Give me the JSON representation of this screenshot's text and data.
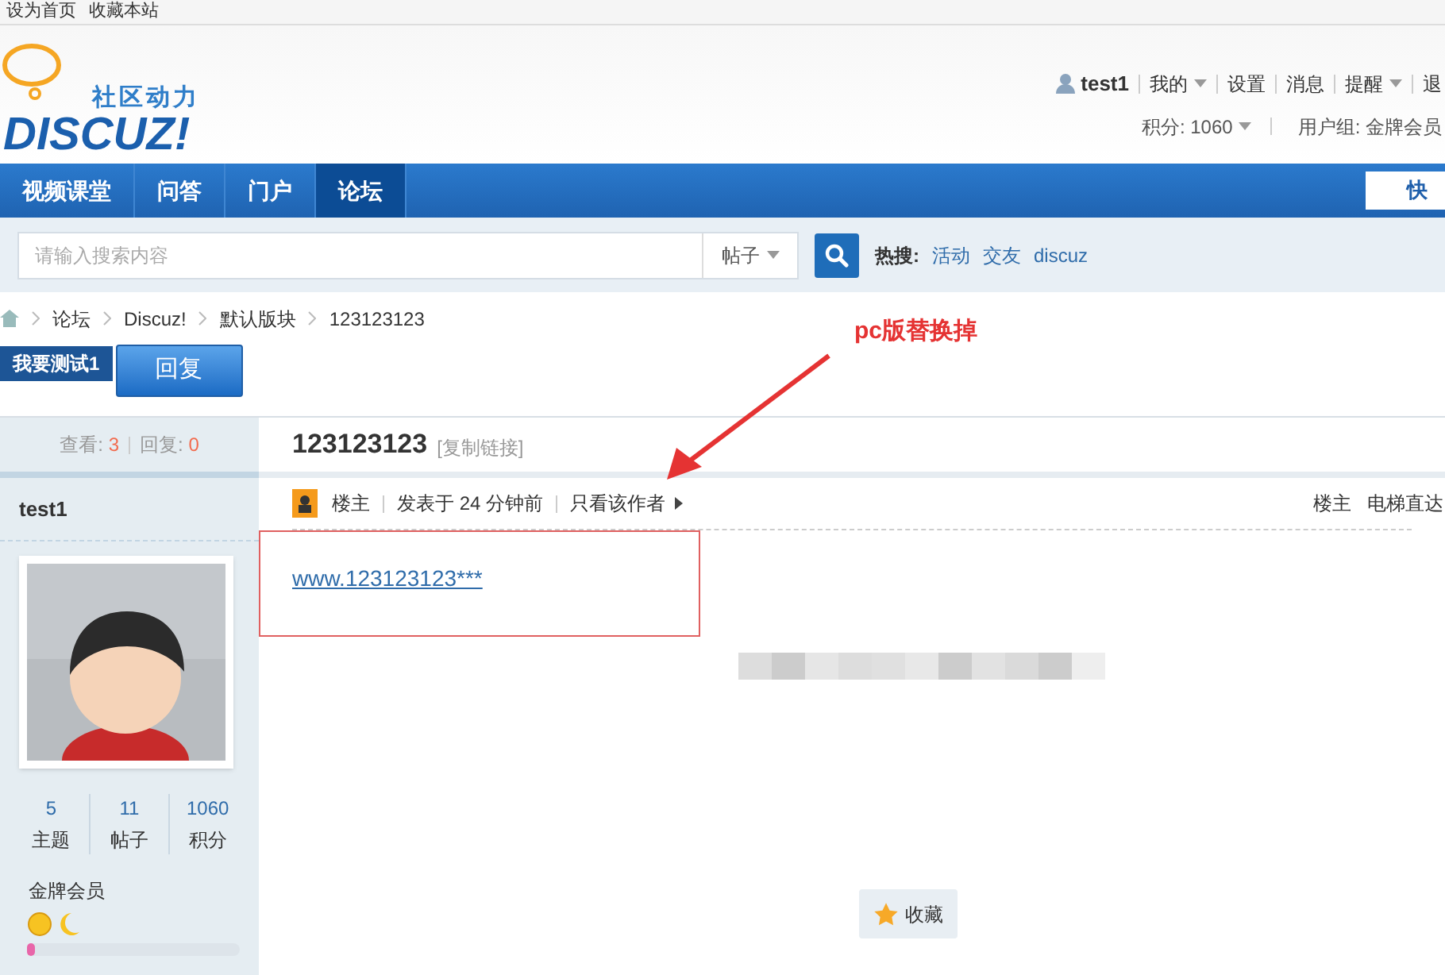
{
  "top_links": [
    "设为首页",
    "收藏本站"
  ],
  "logo": {
    "tagline": "社区动力",
    "wordmark": "DISCUZ!"
  },
  "user_bar": {
    "username": "test1",
    "items": [
      {
        "label": "我的",
        "dropdown": true
      },
      {
        "label": "设置",
        "dropdown": false
      },
      {
        "label": "消息",
        "dropdown": false
      },
      {
        "label": "提醒",
        "dropdown": true
      },
      {
        "label": "退",
        "dropdown": false
      }
    ],
    "credits": "积分: 1060",
    "group": "用户组: 金牌会员"
  },
  "nav": [
    {
      "label": "视频课堂",
      "selected": false
    },
    {
      "label": "问答",
      "selected": false
    },
    {
      "label": "门户",
      "selected": false
    },
    {
      "label": "论坛",
      "selected": true
    }
  ],
  "quick_button": "快",
  "search": {
    "placeholder": "请输入搜索内容",
    "type": "帖子",
    "hot_label": "热搜:",
    "hot": [
      "活动",
      "交友",
      "discuz"
    ]
  },
  "breadcrumb": [
    "论坛",
    "Discuz!",
    "默认版块",
    "123123123"
  ],
  "new_post_button": "我要测试1",
  "reply_button": "回复",
  "thread": {
    "views_label": "查看:",
    "views": "3",
    "replies_label": "回复:",
    "replies": "0",
    "title": "123123123",
    "copy_link": "[复制链接]"
  },
  "author": {
    "name": "test1",
    "stats": [
      {
        "value": "5",
        "label": "主题"
      },
      {
        "value": "11",
        "label": "帖子"
      },
      {
        "value": "1060",
        "label": "积分"
      }
    ],
    "group": "金牌会员",
    "level": 0.04
  },
  "post": {
    "badge": "楼主",
    "time": "发表于 24 分钟前",
    "only_author": "只看该作者",
    "floor": "楼主",
    "jump": "电梯直达",
    "content_link": "www.123123123***",
    "favorite": "收藏"
  },
  "annotation": {
    "text": "pc版替换掉"
  }
}
